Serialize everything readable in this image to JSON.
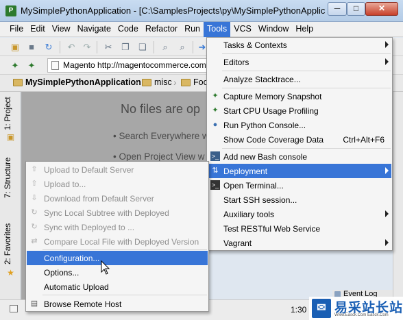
{
  "window": {
    "title": "MySimplePythonApplication - [C:\\SamplesProjects\\py\\MySimplePythonApplicatio...",
    "minimize": "─",
    "maximize": "□",
    "close": "✕"
  },
  "menubar": {
    "items": [
      "File",
      "Edit",
      "View",
      "Navigate",
      "Code",
      "Refactor",
      "Run",
      "Tools",
      "VCS",
      "Window",
      "Help"
    ],
    "active": "Tools"
  },
  "toolbar": {
    "url": "Magento http://magentocommerce.com"
  },
  "breadcrumb": {
    "project": "MySimplePythonApplication",
    "folder": "misc",
    "file": "Foo"
  },
  "left_tabs": {
    "project": "1: Project",
    "structure": "7: Structure",
    "favorites": "2: Favorites"
  },
  "editor": {
    "empty_title": "No files are op",
    "hint1": "• Search Everywhere w",
    "hint2": "• Open Project View w"
  },
  "tools_menu": {
    "items": [
      {
        "label": "Tasks & Contexts",
        "submenu": true,
        "icon": ""
      },
      {
        "label": "Editors",
        "submenu": true,
        "icon": ""
      },
      {
        "label": "Analyze Stacktrace...",
        "submenu": false,
        "icon": ""
      },
      {
        "label": "Capture Memory Snapshot",
        "submenu": false,
        "icon": "memory-snapshot-icon"
      },
      {
        "label": "Start CPU Usage Profiling",
        "submenu": false,
        "icon": "cpu-profiling-icon"
      },
      {
        "label": "Run Python Console...",
        "submenu": false,
        "icon": "python-console-icon"
      },
      {
        "label": "Show Code Coverage Data",
        "shortcut": "Ctrl+Alt+F6",
        "submenu": false,
        "icon": ""
      },
      {
        "label": "Add new Bash console",
        "submenu": false,
        "icon": "bash-console-icon"
      },
      {
        "label": "Deployment",
        "submenu": true,
        "icon": "deployment-icon",
        "selected": true
      },
      {
        "label": "Open Terminal...",
        "submenu": false,
        "icon": "terminal-icon"
      },
      {
        "label": "Start SSH session...",
        "submenu": false,
        "icon": ""
      },
      {
        "label": "Auxiliary tools",
        "submenu": true,
        "icon": ""
      },
      {
        "label": "Test RESTful Web Service",
        "submenu": false,
        "icon": ""
      },
      {
        "label": "Vagrant",
        "submenu": true,
        "icon": ""
      }
    ]
  },
  "deployment_menu": {
    "items": [
      {
        "label": "Upload to Default Server",
        "disabled": true
      },
      {
        "label": "Upload to...",
        "disabled": true
      },
      {
        "label": "Download from Default Server",
        "disabled": true
      },
      {
        "label": "Sync Local Subtree with Deployed",
        "disabled": true
      },
      {
        "label": "Sync with Deployed to ...",
        "disabled": true
      },
      {
        "label": "Compare Local File with Deployed Version",
        "disabled": true
      },
      {
        "label": "Configuration...",
        "selected": true
      },
      {
        "label": "Options..."
      },
      {
        "label": "Automatic Upload"
      },
      {
        "label": "Browse Remote Host"
      }
    ]
  },
  "statusbar": {
    "position": "1:30",
    "event_log": "Event Log"
  },
  "watermark": {
    "text": "易采站长站",
    "sub": "Www.Easck.Com  Easck.Com"
  },
  "colors": {
    "selection": "#3875d7",
    "editor_bg": "#a7a7a7"
  }
}
